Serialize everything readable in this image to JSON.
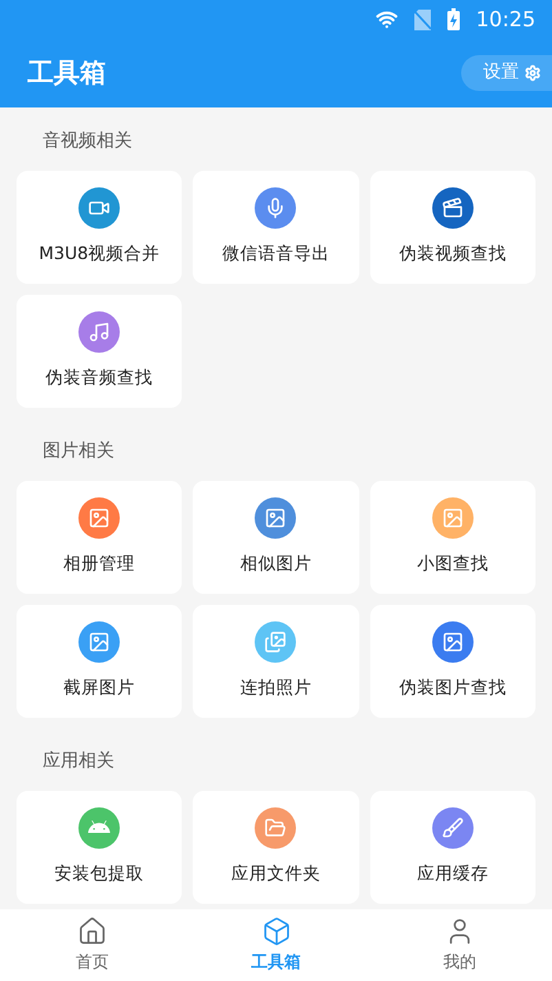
{
  "status_bar": {
    "time": "10:25"
  },
  "header": {
    "title": "工具箱",
    "settings_button": "设置"
  },
  "sections": [
    {
      "title": "音视频相关",
      "tools": [
        {
          "label": "M3U8视频合并",
          "kind": "video",
          "color": "#2196d3"
        },
        {
          "label": "微信语音导出",
          "kind": "mic",
          "color": "#5b8def"
        },
        {
          "label": "伪装视频查找",
          "kind": "clapper",
          "color": "#1565c0"
        },
        {
          "label": "伪装音频查找",
          "kind": "music",
          "color": "#a77de8"
        }
      ]
    },
    {
      "title": "图片相关",
      "tools": [
        {
          "label": "相册管理",
          "kind": "image",
          "color": "#ff7a45"
        },
        {
          "label": "相似图片",
          "kind": "image",
          "color": "#4f8fdc"
        },
        {
          "label": "小图查找",
          "kind": "image",
          "color": "#ffb266"
        },
        {
          "label": "截屏图片",
          "kind": "image",
          "color": "#3aa0f5"
        },
        {
          "label": "连拍照片",
          "kind": "burst",
          "color": "#5ec4f5"
        },
        {
          "label": "伪装图片查找",
          "kind": "image",
          "color": "#3b7cf0"
        }
      ]
    },
    {
      "title": "应用相关",
      "tools": [
        {
          "label": "安装包提取",
          "kind": "android",
          "color": "#4cc46a"
        },
        {
          "label": "应用文件夹",
          "kind": "folder",
          "color": "#f79a6a"
        },
        {
          "label": "应用缓存",
          "kind": "broom",
          "color": "#7b86f2"
        }
      ]
    }
  ],
  "bottom_nav": [
    {
      "label": "首页",
      "kind": "home",
      "selected": false
    },
    {
      "label": "工具箱",
      "kind": "box",
      "selected": true
    },
    {
      "label": "我的",
      "kind": "user",
      "selected": false
    }
  ]
}
